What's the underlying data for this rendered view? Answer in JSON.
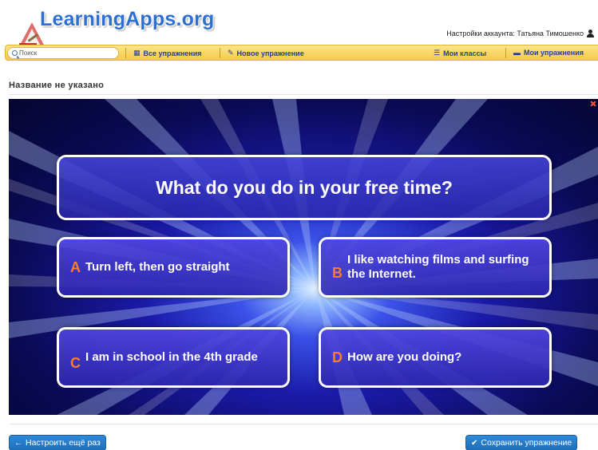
{
  "header": {
    "logo_text": "LearningApps.org",
    "account_label": "Настройки аккаунта: Татьяна Тимошенко"
  },
  "navbar": {
    "search_placeholder": "Поиск",
    "all_exercises": "Все упражнения",
    "new_exercise": "Новое упражнение",
    "my_classes": "Мои классы",
    "my_exercises": "Мои упражнения"
  },
  "page_title": "Название не указано",
  "quiz": {
    "question": "What do you do in your free time?",
    "answers": [
      {
        "letter": "A",
        "text": "Turn left, then go straight"
      },
      {
        "letter": "B",
        "text": "I like watching films and surfing the Internet."
      },
      {
        "letter": "C",
        "text": "I am in school in the 4th grade"
      },
      {
        "letter": "D",
        "text": "How are you doing?"
      }
    ]
  },
  "buttons": {
    "reconfigure": "Настроить ещё раз",
    "save": "Сохранить упражнение"
  },
  "colors": {
    "nav_bg": "#f6c94a",
    "nav_text": "#27408b",
    "answer_letter": "#ff7b2e",
    "button_blue": "#2e8ad8"
  }
}
